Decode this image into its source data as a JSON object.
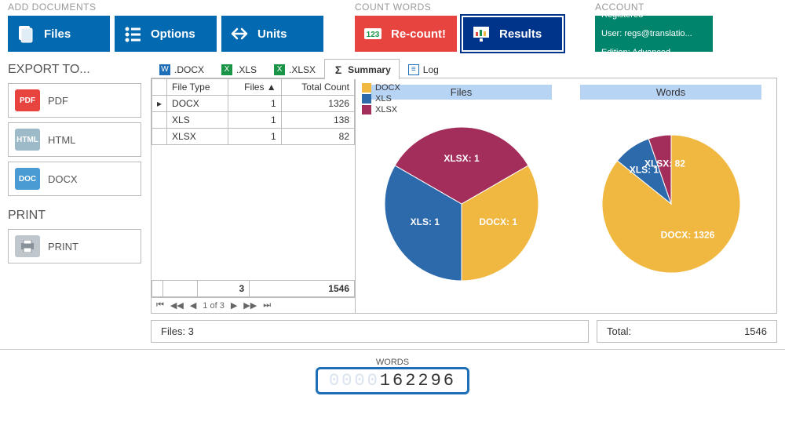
{
  "ribbon": {
    "groups": {
      "add": {
        "title": "ADD DOCUMENTS",
        "files": "Files",
        "options": "Options",
        "units": "Units"
      },
      "count": {
        "title": "COUNT WORDS",
        "recount": "Re-count!",
        "results": "Results"
      },
      "account": {
        "title": "ACCOUNT",
        "line1": "Registered",
        "line2": "User: regs@translatio...",
        "line3": "Edition: Advanced"
      }
    }
  },
  "sidebar": {
    "export_title": "EXPORT TO...",
    "pdf": "PDF",
    "html": "HTML",
    "docx": "DOCX",
    "print_title": "PRINT",
    "print": "PRINT"
  },
  "tabs": {
    "docx": ".DOCX",
    "xls": ".XLS",
    "xlsx": ".XLSX",
    "summary": "Summary",
    "log": "Log"
  },
  "table": {
    "headers": {
      "filetype": "File Type",
      "files": "Files",
      "total": "Total Count"
    },
    "rows": [
      {
        "type": "DOCX",
        "files": "1",
        "total": "1326"
      },
      {
        "type": "XLS",
        "files": "1",
        "total": "138"
      },
      {
        "type": "XLSX",
        "files": "1",
        "total": "82"
      }
    ],
    "foot": {
      "files": "3",
      "total": "1546"
    },
    "pager": "1 of 3"
  },
  "charts": {
    "legend": [
      "DOCX",
      "XLS",
      "XLSX"
    ],
    "colors": {
      "DOCX": "#f0b840",
      "XLS": "#2d6aab",
      "XLSX": "#a32e5c"
    },
    "files_title": "Files",
    "words_title": "Words"
  },
  "footer": {
    "files_label": "Files: 3",
    "total_label": "Total:",
    "total_value": "1546"
  },
  "counter": {
    "label": "WORDS",
    "faded": "0000",
    "value": "162296"
  },
  "chart_data": [
    {
      "type": "pie",
      "title": "Files",
      "categories": [
        "DOCX",
        "XLS",
        "XLSX"
      ],
      "values": [
        1,
        1,
        1
      ],
      "labels": [
        "DOCX: 1",
        "XLS: 1",
        "XLSX: 1"
      ],
      "colors": [
        "#f0b840",
        "#2d6aab",
        "#a32e5c"
      ]
    },
    {
      "type": "pie",
      "title": "Words",
      "categories": [
        "DOCX",
        "XLS",
        "XLSX"
      ],
      "values": [
        1326,
        138,
        82
      ],
      "labels": [
        "DOCX: 1326",
        "XLS: 138",
        "XLSX: 82"
      ],
      "colors": [
        "#f0b840",
        "#2d6aab",
        "#a32e5c"
      ]
    }
  ]
}
